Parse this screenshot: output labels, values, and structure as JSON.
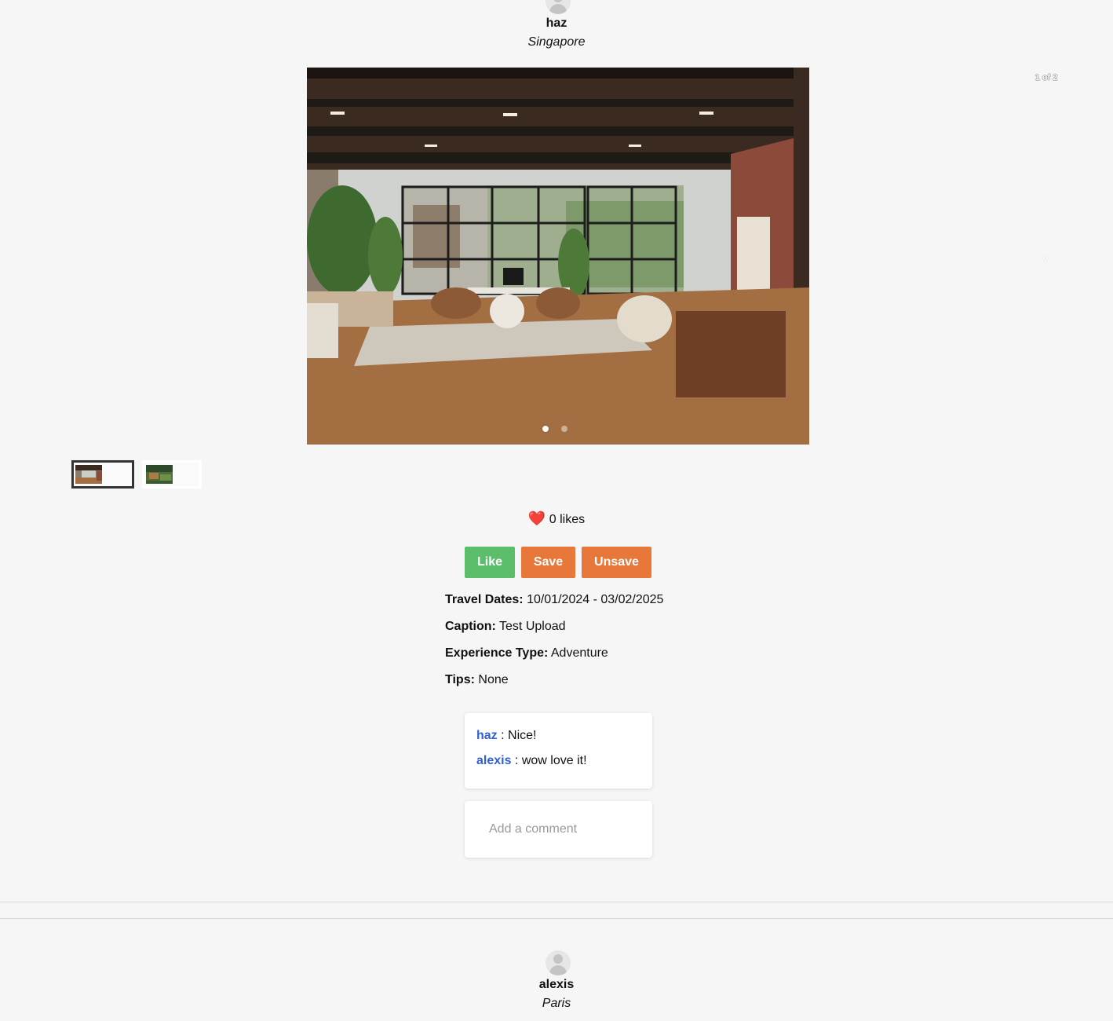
{
  "colors": {
    "background": "#f6f6f6",
    "like_button": "#5cbd6a",
    "save_button": "#e8773a",
    "unsave_button": "#e8773a",
    "comment_author": "#2f5fd6"
  },
  "posts": [
    {
      "username": "haz",
      "location": "Singapore",
      "carousel": {
        "slide_counter": "1 of 2",
        "current_slide": 1,
        "total_slides": 2,
        "next_icon": "chevron-right-icon"
      },
      "likes": {
        "icon": "heart-icon",
        "emoji": "❤️",
        "text": "0 likes"
      },
      "actions": {
        "like_label": "Like",
        "save_label": "Save",
        "unsave_label": "Unsave"
      },
      "details": {
        "travel_dates_label": "Travel Dates:",
        "travel_dates_value": "10/01/2024 - 03/02/2025",
        "caption_label": "Caption:",
        "caption_value": "Test Upload",
        "experience_label": "Experience Type:",
        "experience_value": "Adventure",
        "tips_label": "Tips:",
        "tips_value": "None"
      },
      "comments": [
        {
          "author": "haz",
          "separator": " : ",
          "text": "Nice!"
        },
        {
          "author": "alexis",
          "separator": " : ",
          "text": "wow love it!"
        }
      ],
      "comment_input": {
        "placeholder": "Add a comment",
        "value": ""
      }
    },
    {
      "username": "alexis",
      "location": "Paris"
    }
  ]
}
